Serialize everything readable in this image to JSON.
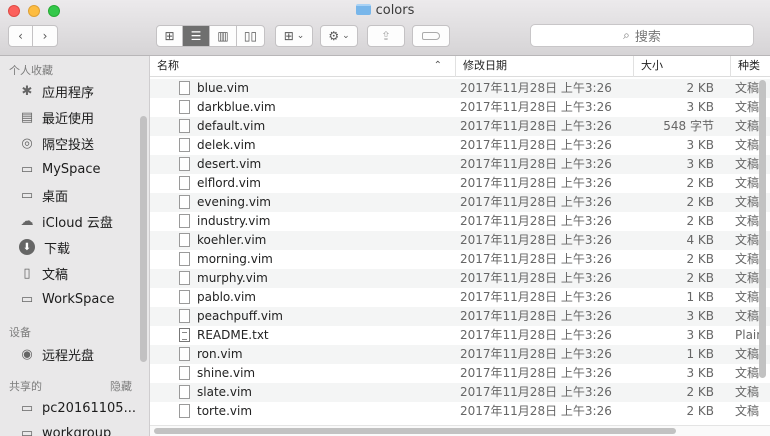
{
  "window": {
    "title": "colors"
  },
  "search": {
    "placeholder": "搜索"
  },
  "sidebar": {
    "favorites_label": "个人收藏",
    "favorites": [
      {
        "label": "应用程序",
        "icon": "applications-icon"
      },
      {
        "label": "最近使用",
        "icon": "recents-icon"
      },
      {
        "label": "隔空投送",
        "icon": "airdrop-icon"
      },
      {
        "label": "MySpace",
        "icon": "folder-icon"
      },
      {
        "label": "桌面",
        "icon": "desktop-icon"
      },
      {
        "label": "iCloud 云盘",
        "icon": "icloud-icon"
      },
      {
        "label": "下载",
        "icon": "downloads-icon"
      },
      {
        "label": "文稿",
        "icon": "documents-icon"
      },
      {
        "label": "WorkSpace",
        "icon": "folder-icon"
      }
    ],
    "devices_label": "设备",
    "devices": [
      {
        "label": "远程光盘",
        "icon": "disc-icon"
      }
    ],
    "shared_label": "共享的",
    "shared_hide": "隐藏",
    "shared": [
      {
        "label": "pc20161105...",
        "icon": "computer-icon"
      },
      {
        "label": "workgroup",
        "icon": "computer-icon"
      }
    ]
  },
  "columns": {
    "name": "名称",
    "date": "修改日期",
    "size": "大小",
    "kind": "种类"
  },
  "files": [
    {
      "name": "blue.vim",
      "date": "2017年11月28日 上午3:26",
      "size": "2 KB",
      "kind": "文稿"
    },
    {
      "name": "darkblue.vim",
      "date": "2017年11月28日 上午3:26",
      "size": "3 KB",
      "kind": "文稿"
    },
    {
      "name": "default.vim",
      "date": "2017年11月28日 上午3:26",
      "size": "548 字节",
      "kind": "文稿"
    },
    {
      "name": "delek.vim",
      "date": "2017年11月28日 上午3:26",
      "size": "3 KB",
      "kind": "文稿"
    },
    {
      "name": "desert.vim",
      "date": "2017年11月28日 上午3:26",
      "size": "3 KB",
      "kind": "文稿"
    },
    {
      "name": "elflord.vim",
      "date": "2017年11月28日 上午3:26",
      "size": "2 KB",
      "kind": "文稿"
    },
    {
      "name": "evening.vim",
      "date": "2017年11月28日 上午3:26",
      "size": "2 KB",
      "kind": "文稿"
    },
    {
      "name": "industry.vim",
      "date": "2017年11月28日 上午3:26",
      "size": "2 KB",
      "kind": "文稿"
    },
    {
      "name": "koehler.vim",
      "date": "2017年11月28日 上午3:26",
      "size": "4 KB",
      "kind": "文稿"
    },
    {
      "name": "morning.vim",
      "date": "2017年11月28日 上午3:26",
      "size": "2 KB",
      "kind": "文稿"
    },
    {
      "name": "murphy.vim",
      "date": "2017年11月28日 上午3:26",
      "size": "2 KB",
      "kind": "文稿"
    },
    {
      "name": "pablo.vim",
      "date": "2017年11月28日 上午3:26",
      "size": "1 KB",
      "kind": "文稿"
    },
    {
      "name": "peachpuff.vim",
      "date": "2017年11月28日 上午3:26",
      "size": "3 KB",
      "kind": "文稿"
    },
    {
      "name": "README.txt",
      "date": "2017年11月28日 上午3:26",
      "size": "3 KB",
      "kind": "Plain"
    },
    {
      "name": "ron.vim",
      "date": "2017年11月28日 上午3:26",
      "size": "1 KB",
      "kind": "文稿"
    },
    {
      "name": "shine.vim",
      "date": "2017年11月28日 上午3:26",
      "size": "3 KB",
      "kind": "文稿"
    },
    {
      "name": "slate.vim",
      "date": "2017年11月28日 上午3:26",
      "size": "2 KB",
      "kind": "文稿"
    },
    {
      "name": "torte.vim",
      "date": "2017年11月28日 上午3:26",
      "size": "2 KB",
      "kind": "文稿"
    }
  ],
  "colors": {
    "close": "#fc605c",
    "minimize": "#fdbc40",
    "zoom": "#34c84a",
    "folder": "#78b6ea"
  }
}
